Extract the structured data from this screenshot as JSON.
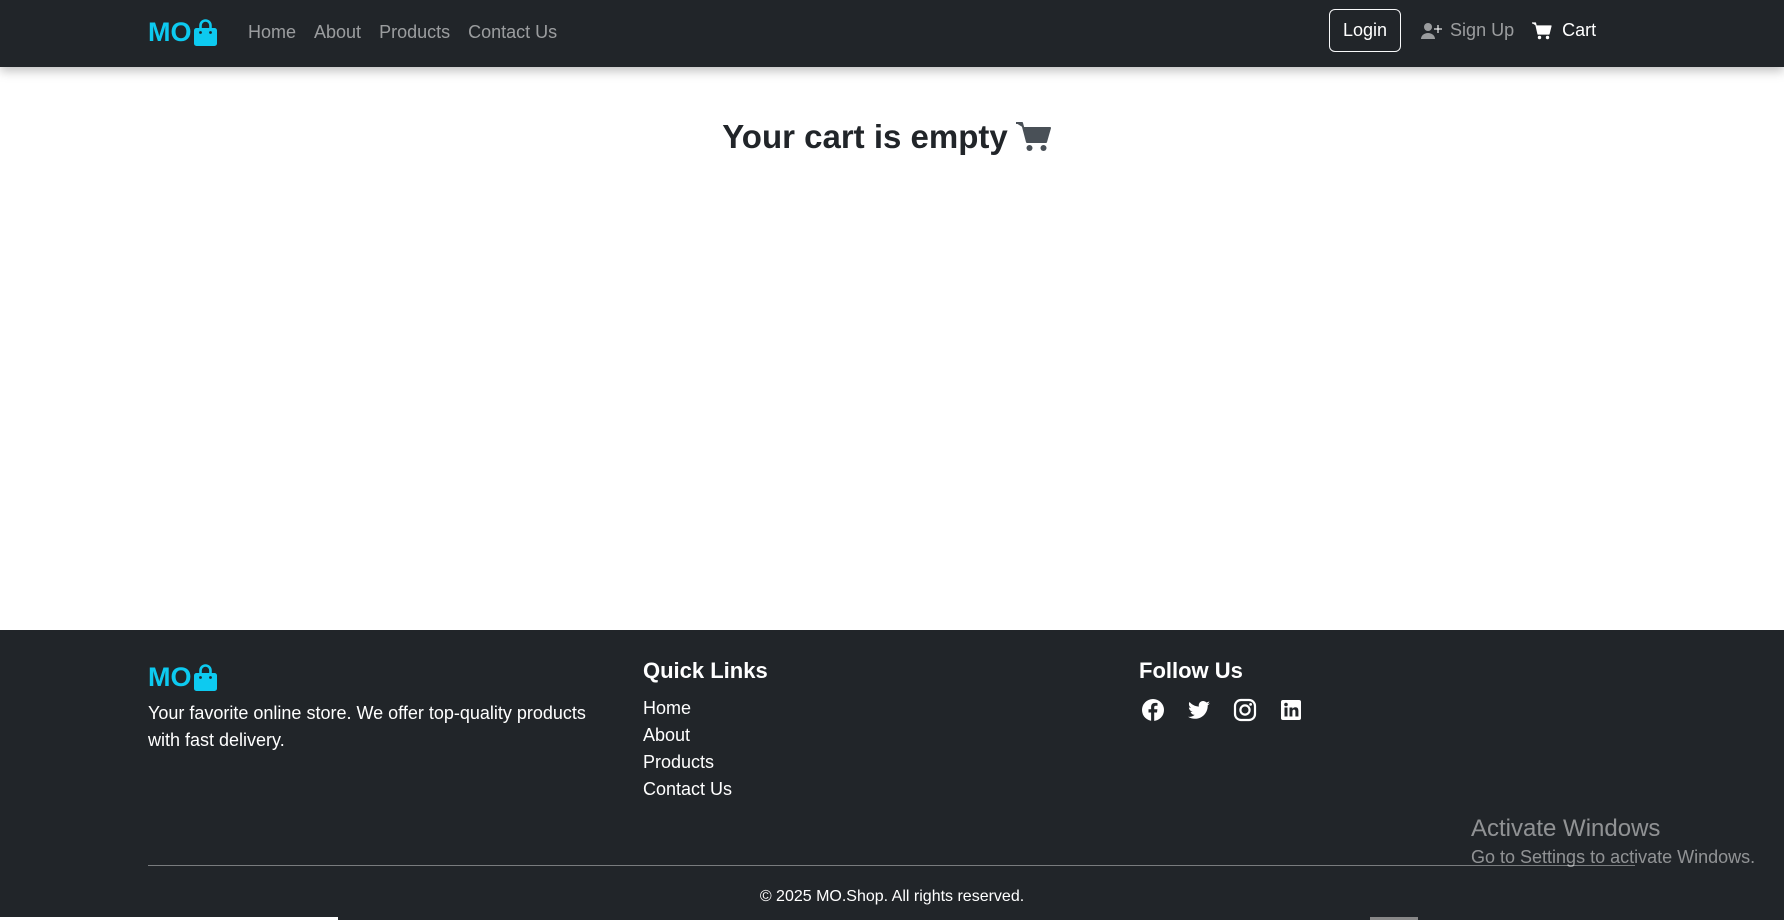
{
  "navbar": {
    "brand": "MO",
    "links": [
      "Home",
      "About",
      "Products",
      "Contact Us"
    ],
    "login_label": "Login",
    "signup_label": "Sign Up",
    "cart_label": "Cart"
  },
  "main": {
    "empty_message": "Your cart is empty"
  },
  "footer": {
    "brand": "MO",
    "description": "Your favorite online store. We offer top-quality products with fast delivery.",
    "quick_links_heading": "Quick Links",
    "quick_links": [
      "Home",
      "About",
      "Products",
      "Contact Us"
    ],
    "follow_heading": "Follow Us",
    "social_icons": [
      "facebook-icon",
      "twitter-icon",
      "instagram-icon",
      "linkedin-icon"
    ],
    "copyright": "© 2025 MO.Shop. All rights reserved."
  },
  "watermark": {
    "title": "Activate Windows",
    "subtitle": "Go to Settings to activate Windows."
  },
  "colors": {
    "dark": "#212529",
    "brand": "#0dcaf0",
    "muted_link": "rgba(255,255,255,0.55)"
  }
}
